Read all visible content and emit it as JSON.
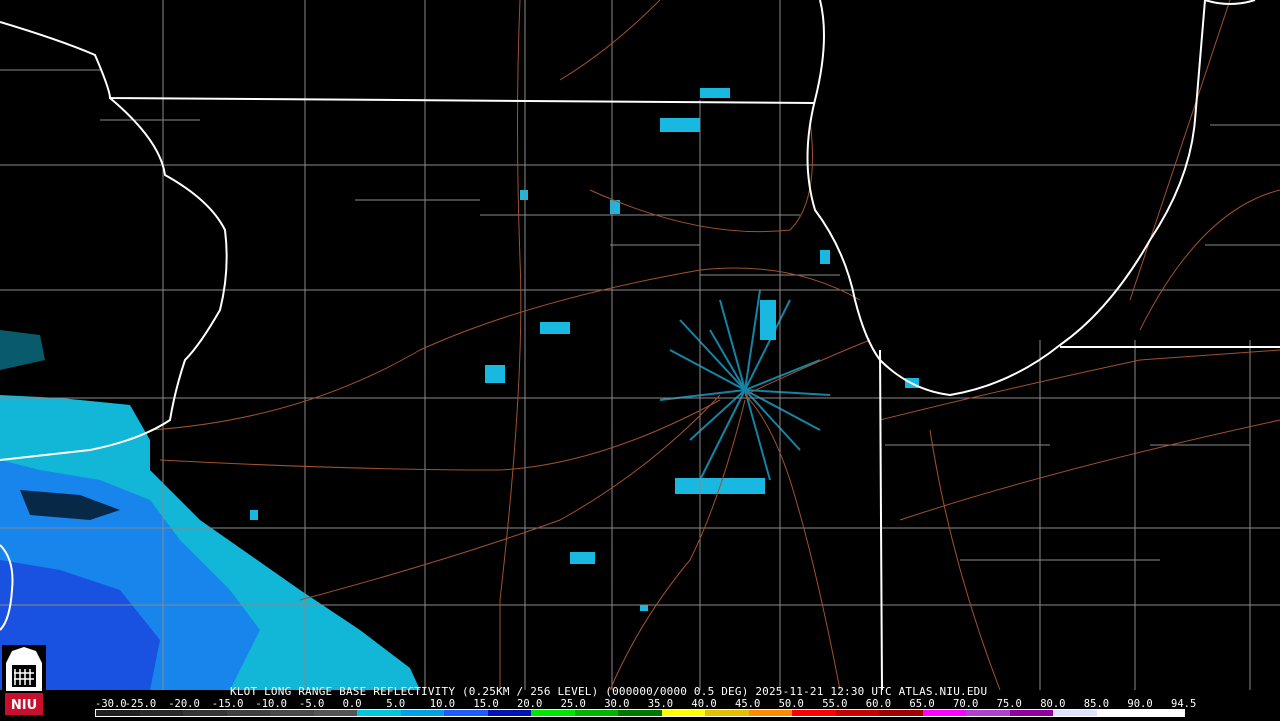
{
  "product": {
    "title": "KLOT LONG RANGE BASE REFLECTIVITY (0.25KM / 256 LEVEL) (000000/0000 0.5 DEG) 2025-11-21 12:30 UTC  ATLAS.NIU.EDU",
    "logo_text": "NIU"
  },
  "colors": {
    "background": "#000000",
    "state_lines": "#ffffff",
    "county_lines": "#8a8a8a",
    "highways": "#a0522d",
    "weak_echo": "#00c8dc",
    "moderate_echo": "#1e5cff"
  },
  "scale": {
    "labels": [
      "-30.0",
      "-25.0",
      "-20.0",
      "-15.0",
      "-10.0",
      "-5.0",
      "0.0",
      "5.0",
      "10.0",
      "15.0",
      "20.0",
      "25.0",
      "30.0",
      "35.0",
      "40.0",
      "45.0",
      "50.0",
      "55.0",
      "60.0",
      "65.0",
      "70.0",
      "75.0",
      "80.0",
      "85.0",
      "90.0",
      "94.5"
    ],
    "colors": [
      "#202020",
      "#2a2a2a",
      "#353535",
      "#404040",
      "#4a4a4a",
      "#555555",
      "#00c8dc",
      "#00a0e6",
      "#1e5cff",
      "#0014b4",
      "#00e600",
      "#00b400",
      "#007800",
      "#ffff00",
      "#e6c000",
      "#ff8c00",
      "#ff0000",
      "#c80000",
      "#a00000",
      "#ff00ff",
      "#b040d0",
      "#9000a0",
      "#e0e0ff",
      "#ffffff",
      "#ffffff"
    ]
  }
}
